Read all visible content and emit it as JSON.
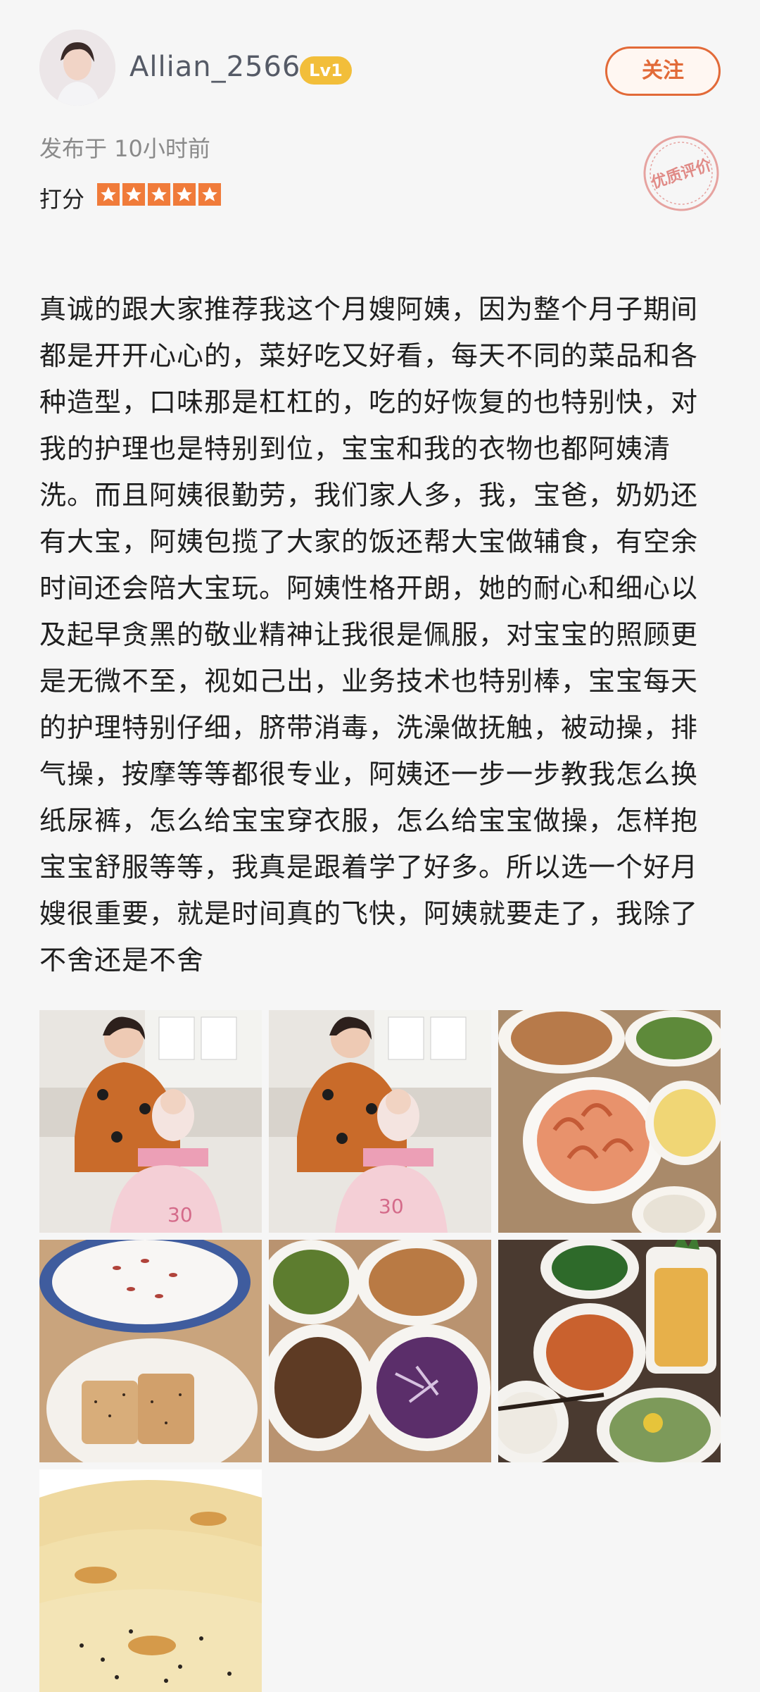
{
  "user": {
    "name": "Allian_2566",
    "level": "Lv1",
    "follow_label": "关注"
  },
  "meta": {
    "published": "发布于 10小时前",
    "rating_label": "打分",
    "rating": 5,
    "stamp": "优质评价"
  },
  "review": {
    "text": "真诚的跟大家推荐我这个月嫂阿姨，因为整个月子期间都是开开心心的，菜好吃又好看，每天不同的菜品和各种造型，口味那是杠杠的，吃的好恢复的也特别快，对我的护理也是特别到位，宝宝和我的衣物也都阿姨清洗。而且阿姨很勤劳，我们家人多，我，宝爸，奶奶还有大宝，阿姨包揽了大家的饭还帮大宝做辅食，有空余时间还会陪大宝玩。阿姨性格开朗，她的耐心和细心以及起早贪黑的敬业精神让我很是佩服，对宝宝的照顾更是无微不至，视如己出，业务技术也特别棒，宝宝每天的护理特别仔细，脐带消毒，洗澡做抚触，被动操，排气操，按摩等等都很专业，阿姨还一步一步教我怎么换纸尿裤，怎么给宝宝穿衣服，怎么给宝宝做操，怎样抱宝宝舒服等等，我真是跟着学了好多。所以选一个好月嫂很重要，就是时间真的飞快，阿姨就要走了，我除了不舍还是不舍"
  },
  "photos": [
    {
      "id": "photo-mother-baby-1",
      "cake_number": "30"
    },
    {
      "id": "photo-mother-baby-2",
      "cake_number": "30"
    },
    {
      "id": "photo-shrimp-dishes"
    },
    {
      "id": "photo-porridge-pancake"
    },
    {
      "id": "photo-four-dishes"
    },
    {
      "id": "photo-meal-pineapple"
    },
    {
      "id": "photo-sesame-flatbread"
    }
  ],
  "colors": {
    "accent": "#e26a38",
    "star": "#f07b3a",
    "badge": "#f2be3a",
    "background": "#f6f6f6"
  }
}
